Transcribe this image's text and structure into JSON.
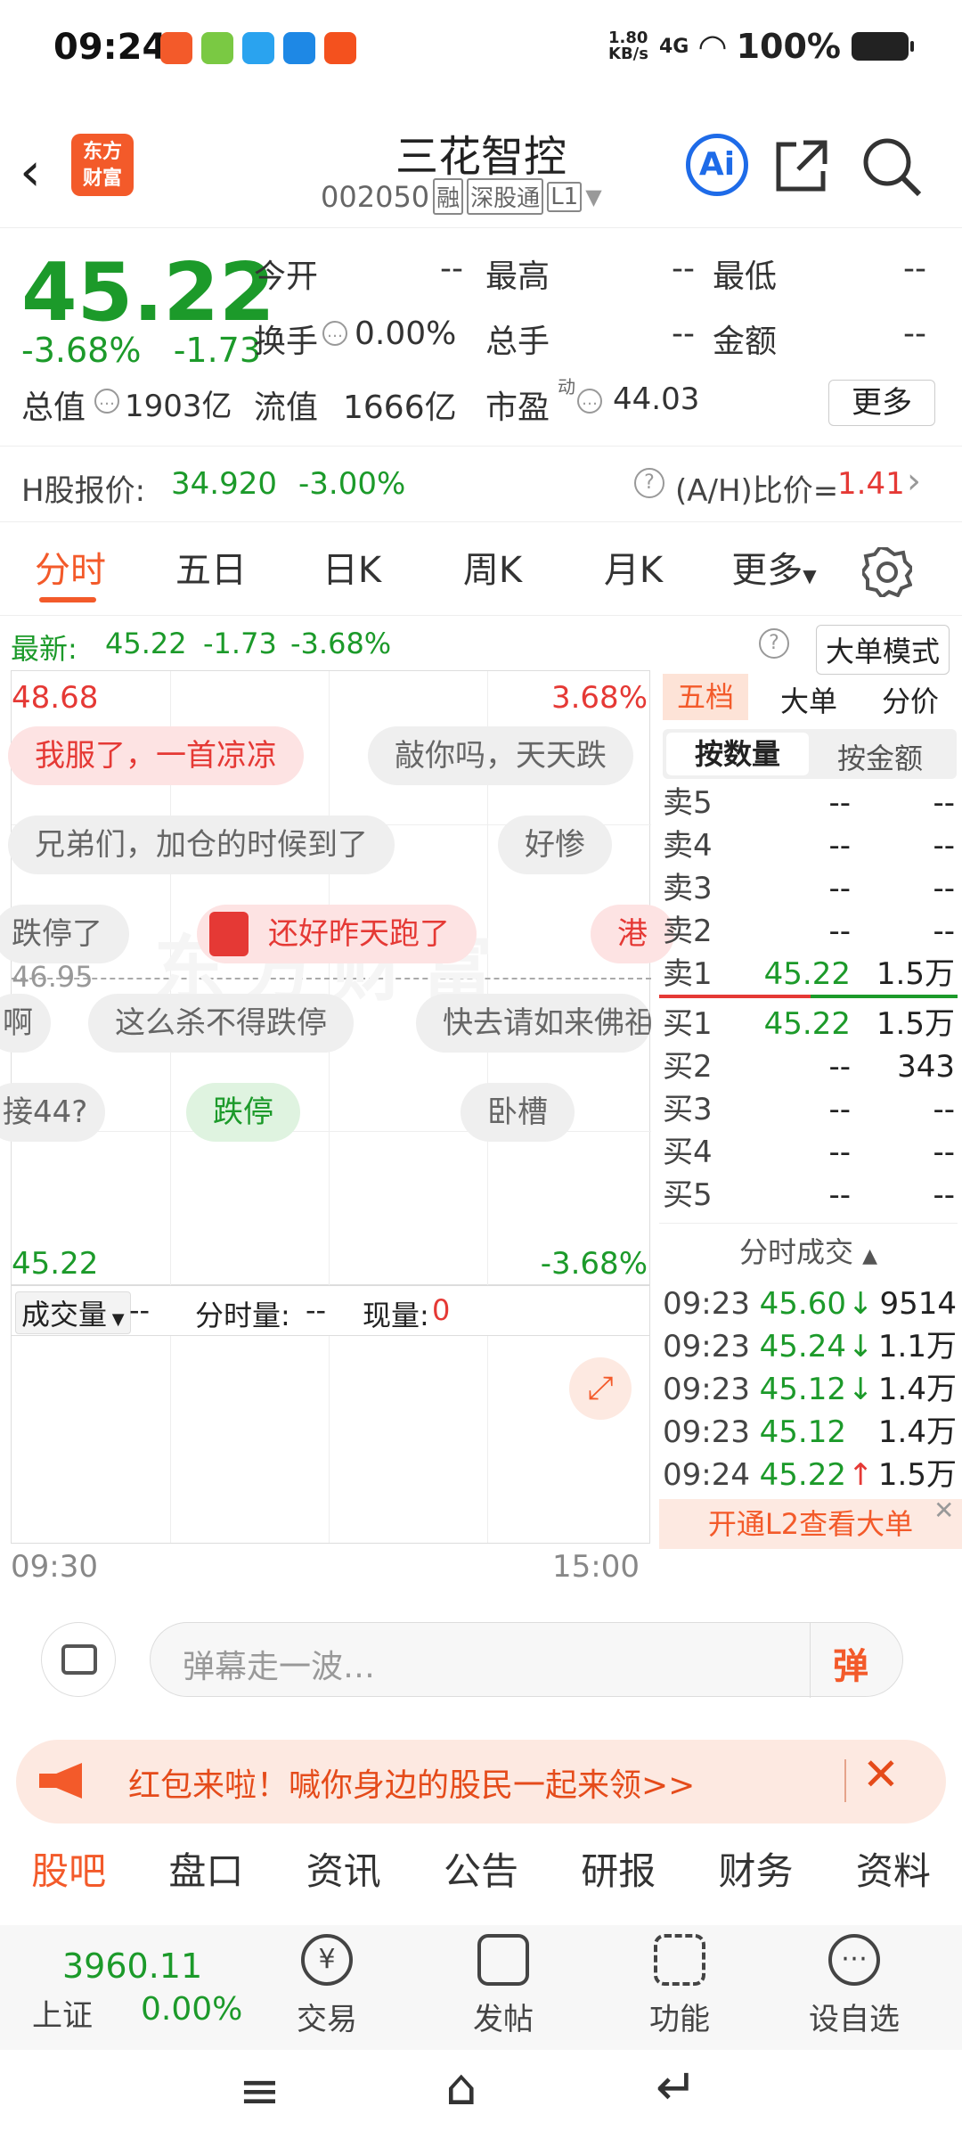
{
  "status": {
    "time": "09:24",
    "netspeed": "1.80\nKB/s",
    "signal": "4G",
    "battery": "100%"
  },
  "header": {
    "logo_line1": "东方",
    "logo_line2": "财富",
    "title": "三花智控",
    "code": "002050",
    "tag1": "融",
    "tag2": "深股通",
    "tag3": "L1",
    "ai": "Ai"
  },
  "quote": {
    "price": "45.22",
    "pct": "-3.68%",
    "chg": "-1.73",
    "open_label": "今开",
    "open": "--",
    "high_label": "最高",
    "high": "--",
    "low_label": "最低",
    "low": "--",
    "turnover_label": "换手",
    "turnover": "0.00%",
    "volume_label": "总手",
    "volume": "--",
    "amount_label": "金额",
    "amount": "--",
    "mktcap_label": "总值",
    "mktcap": "1903亿",
    "float_label": "流值",
    "float": "1666亿",
    "pe_label": "市盈",
    "pe_sup": "动",
    "pe": "44.03",
    "more": "更多"
  },
  "hshare": {
    "label": "H股报价:",
    "price": "34.920",
    "pct": "-3.00%",
    "ah_label": "(A/H)比价=",
    "ah": "1.41"
  },
  "tabs": [
    "分时",
    "五日",
    "日K",
    "周K",
    "月K",
    "更多"
  ],
  "latest": {
    "label": "最新:",
    "price": "45.22",
    "chg": "-1.73",
    "pct": "-3.68%",
    "mode": "大单模式"
  },
  "chart": {
    "top_price": "48.68",
    "top_pct": "3.68%",
    "mid_price": "46.95",
    "bottom_price": "45.22",
    "bottom_pct": "-3.68%",
    "start_time": "09:30",
    "end_time": "15:00",
    "danmu": [
      "我服了，一首凉凉",
      "敲你吗，天天跌",
      "兄弟们，加仓的时候到了",
      "好惨",
      "跌停了",
      "还好昨天跑了",
      "港",
      "啊",
      "这么杀不得跌停",
      "快去请如来佛祖",
      "接44?",
      "跌停",
      "卧槽"
    ],
    "vol_label": "成交量",
    "vol_value": "--",
    "minute_vol_label": "分时量:",
    "minute_vol": "--",
    "now_vol_label": "现量:",
    "now_vol": "0",
    "watermark": "东方财富"
  },
  "book": {
    "tabs": [
      "五档",
      "大单",
      "分价"
    ],
    "subtabs": [
      "按数量",
      "按金额"
    ],
    "asks": [
      {
        "label": "卖5",
        "price": "--",
        "vol": "--"
      },
      {
        "label": "卖4",
        "price": "--",
        "vol": "--"
      },
      {
        "label": "卖3",
        "price": "--",
        "vol": "--"
      },
      {
        "label": "卖2",
        "price": "--",
        "vol": "--"
      },
      {
        "label": "卖1",
        "price": "45.22",
        "vol": "1.5万"
      }
    ],
    "bids": [
      {
        "label": "买1",
        "price": "45.22",
        "vol": "1.5万"
      },
      {
        "label": "买2",
        "price": "--",
        "vol": "343"
      },
      {
        "label": "买3",
        "price": "--",
        "vol": "--"
      },
      {
        "label": "买4",
        "price": "--",
        "vol": "--"
      },
      {
        "label": "买5",
        "price": "--",
        "vol": "--"
      }
    ],
    "trades_title": "分时成交",
    "trades": [
      {
        "t": "09:23",
        "p": "45.60",
        "arrow": "↓",
        "v": "9514"
      },
      {
        "t": "09:23",
        "p": "45.24",
        "arrow": "↓",
        "v": "1.1万"
      },
      {
        "t": "09:23",
        "p": "45.12",
        "arrow": "↓",
        "v": "1.4万"
      },
      {
        "t": "09:23",
        "p": "45.12",
        "arrow": "",
        "v": "1.4万"
      },
      {
        "t": "09:24",
        "p": "45.22",
        "arrow": "↑",
        "v": "1.5万"
      }
    ],
    "l2": "开通L2查看大单"
  },
  "danmu_input": {
    "placeholder": "弹幕走一波…",
    "send": "弹"
  },
  "promo": {
    "text": "红包来啦！喊你身边的股民一起来领>>"
  },
  "subtabs": [
    "股吧",
    "盘口",
    "资讯",
    "公告",
    "研报",
    "财务",
    "资料"
  ],
  "bottombar": {
    "index_value": "3960.11",
    "index_name": "上证",
    "index_pct": "0.00%",
    "trade": "交易",
    "post": "发帖",
    "func": "功能",
    "watch": "设自选"
  }
}
